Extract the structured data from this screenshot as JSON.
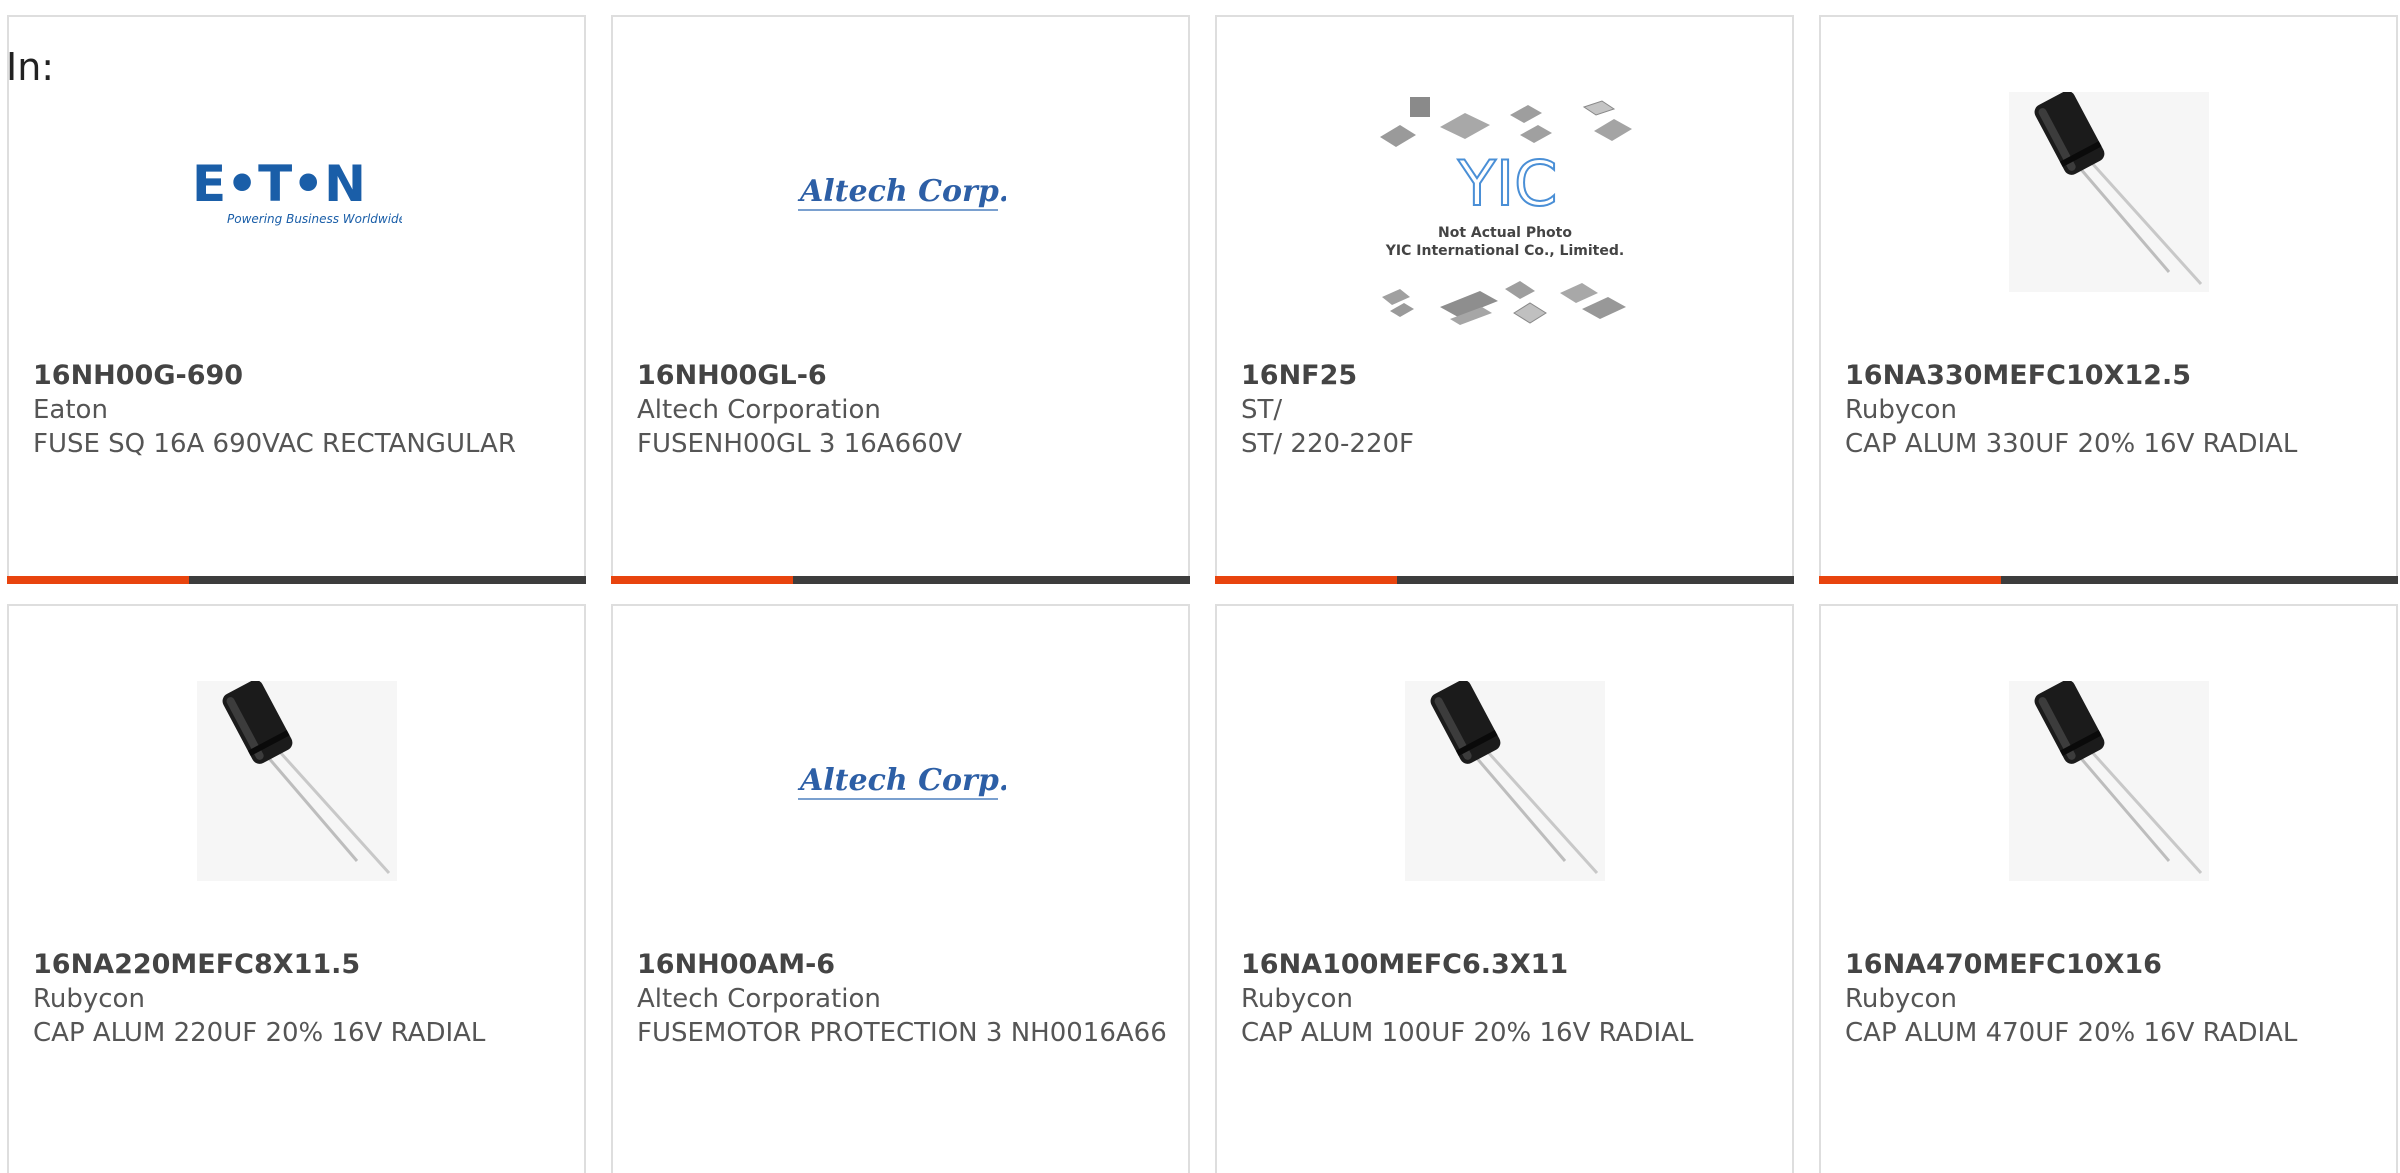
{
  "intro_label": "In:",
  "colors": {
    "accent": "#e8440e",
    "bar": "#3d3d3d",
    "eaton_blue": "#1a5ea8",
    "altech_blue": "#2d5fa6"
  },
  "products": [
    {
      "part": "16NH00G-690",
      "manufacturer": "Eaton",
      "description": "FUSE SQ 16A 690VAC RECTANGULAR",
      "image": "eaton-logo",
      "logo_text": "E•T•N",
      "logo_tagline": "Powering Business Worldwide"
    },
    {
      "part": "16NH00GL-6",
      "manufacturer": "Altech Corporation",
      "description": "FUSENH00GL 3 16A660V",
      "image": "altech-logo",
      "logo_text": "Altech Corp."
    },
    {
      "part": "16NF25",
      "manufacturer": "ST/",
      "description": "ST/ 220-220F",
      "image": "yic-placeholder",
      "logo_text": "YIC",
      "logo_note_1": "Not Actual Photo",
      "logo_note_2": "YIC International Co., Limited."
    },
    {
      "part": "16NA330MEFC10X12.5",
      "manufacturer": "Rubycon",
      "description": "CAP ALUM 330UF 20% 16V RADIAL",
      "image": "capacitor-photo"
    },
    {
      "part": "16NA220MEFC8X11.5",
      "manufacturer": "Rubycon",
      "description": "CAP ALUM 220UF 20% 16V RADIAL",
      "image": "capacitor-photo"
    },
    {
      "part": "16NH00AM-6",
      "manufacturer": "Altech Corporation",
      "description": "FUSEMOTOR PROTECTION 3 NH0016A66",
      "image": "altech-logo",
      "logo_text": "Altech Corp."
    },
    {
      "part": "16NA100MEFC6.3X11",
      "manufacturer": "Rubycon",
      "description": "CAP ALUM 100UF 20% 16V RADIAL",
      "image": "capacitor-photo"
    },
    {
      "part": "16NA470MEFC10X16",
      "manufacturer": "Rubycon",
      "description": "CAP ALUM 470UF 20% 16V RADIAL",
      "image": "capacitor-photo"
    }
  ]
}
